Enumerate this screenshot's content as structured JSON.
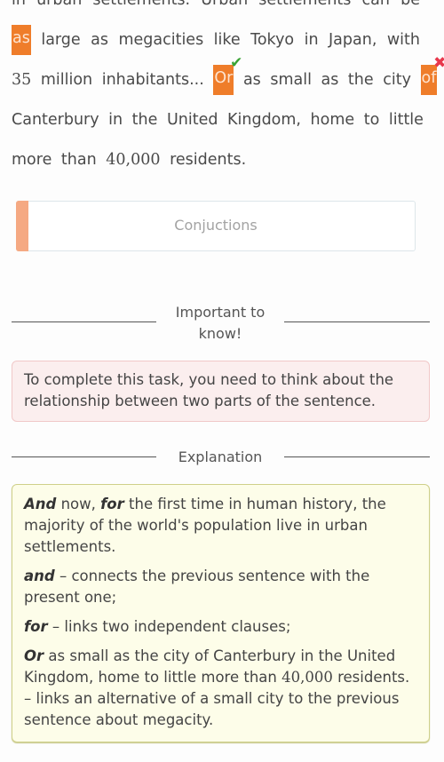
{
  "passage": {
    "line0": "in urban settlements. Urban settlements can be",
    "gap1": "as",
    "line1_rest": "large as megacities like Tokyo in Japan, with",
    "line2_num": "35",
    "line2_text": "million inhabitants...",
    "gap2": "Or",
    "gap2_status": "correct",
    "line2_mid": "as small as the city",
    "gap3": "of",
    "gap3_status": "incorrect",
    "line3": "Canterbury in the United Kingdom, home to little",
    "line4_a": "more than",
    "line4_num": "40,000",
    "line4_b": "residents."
  },
  "icons": {
    "correct": "✔",
    "incorrect": "✖"
  },
  "colors": {
    "gap_fill": "#ef7d2a",
    "correct": "#3aa335",
    "incorrect": "#e8384c",
    "topic_bar": "#f5a983"
  },
  "topic": {
    "label": "Conjuctions"
  },
  "important": {
    "title_line1": "Important to",
    "title_line2": "know!",
    "text": "To complete this task, you need to think about the relationship between two parts of the sentence."
  },
  "explanation": {
    "title": "Explanation",
    "p1_b1": "And",
    "p1_t1": " now, ",
    "p1_b2": "for",
    "p1_t2": " the first time in human history, the majority of the world's population live in urban settlements.",
    "p2_b": "and",
    "p2_t": " – connects the previous sentence with the present one;",
    "p3_b": "for",
    "p3_t": " – links two independent clauses;",
    "p4_b": "Or",
    "p4_t1": " as small as the city of Canterbury in the United Kingdom, home to little more than ",
    "p4_num": "40,000",
    "p4_t2": " residents. – links an alternative of a small city to the previous sentence about megacity."
  }
}
